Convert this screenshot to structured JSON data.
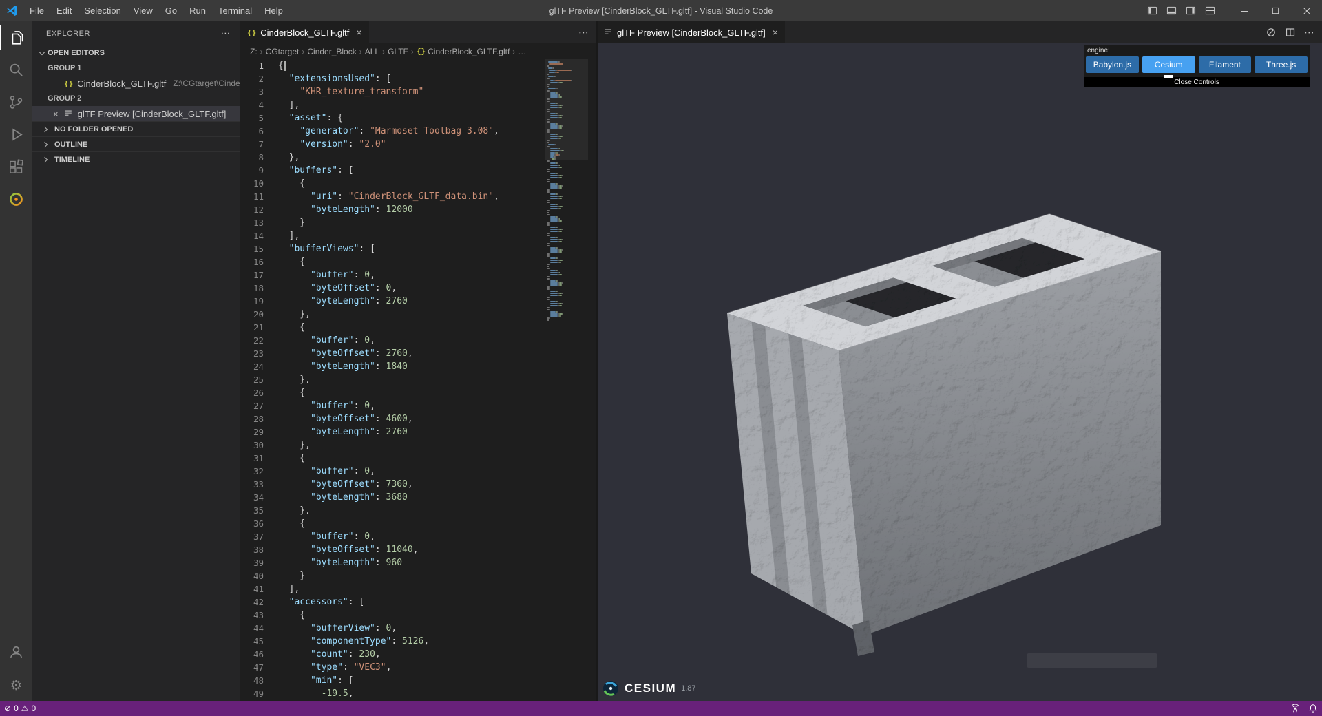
{
  "window": {
    "title": "glTF Preview [CinderBlock_GLTF.gltf] - Visual Studio Code",
    "menus": [
      "File",
      "Edit",
      "Selection",
      "View",
      "Go",
      "Run",
      "Terminal",
      "Help"
    ]
  },
  "explorer": {
    "title": "EXPLORER",
    "open_editors_label": "OPEN EDITORS",
    "group1_label": "GROUP 1",
    "group1_file": {
      "name": "CinderBlock_GLTF.gltf",
      "description": "Z:\\CGtarget\\Cinder…"
    },
    "group2_label": "GROUP 2",
    "group2_item": {
      "name": "glTF Preview [CinderBlock_GLTF.gltf]"
    },
    "sections": [
      {
        "label": "NO FOLDER OPENED"
      },
      {
        "label": "OUTLINE"
      },
      {
        "label": "TIMELINE"
      }
    ]
  },
  "editor": {
    "tab_label": "CinderBlock_GLTF.gltf",
    "breadcrumbs": [
      {
        "label": "Z:"
      },
      {
        "label": "CGtarget"
      },
      {
        "label": "Cinder_Block"
      },
      {
        "label": "ALL"
      },
      {
        "label": "GLTF"
      },
      {
        "label": "CinderBlock_GLTF.gltf",
        "icon": "json"
      },
      {
        "label": "…"
      }
    ],
    "code": {
      "lines": [
        [
          [
            "pl",
            "{"
          ]
        ],
        [
          [
            "pl",
            "  "
          ],
          [
            "k",
            "\"extensionsUsed\""
          ],
          [
            "pl",
            ": ["
          ]
        ],
        [
          [
            "pl",
            "    "
          ],
          [
            "s",
            "\"KHR_texture_transform\""
          ]
        ],
        [
          [
            "pl",
            "  ],"
          ]
        ],
        [
          [
            "pl",
            "  "
          ],
          [
            "k",
            "\"asset\""
          ],
          [
            "pl",
            ": {"
          ]
        ],
        [
          [
            "pl",
            "    "
          ],
          [
            "k",
            "\"generator\""
          ],
          [
            "pl",
            ": "
          ],
          [
            "s",
            "\"Marmoset Toolbag 3.08\""
          ],
          [
            "pl",
            ","
          ]
        ],
        [
          [
            "pl",
            "    "
          ],
          [
            "k",
            "\"version\""
          ],
          [
            "pl",
            ": "
          ],
          [
            "s",
            "\"2.0\""
          ]
        ],
        [
          [
            "pl",
            "  },"
          ]
        ],
        [
          [
            "pl",
            "  "
          ],
          [
            "k",
            "\"buffers\""
          ],
          [
            "pl",
            ": ["
          ]
        ],
        [
          [
            "pl",
            "    {"
          ]
        ],
        [
          [
            "pl",
            "      "
          ],
          [
            "k",
            "\"uri\""
          ],
          [
            "pl",
            ": "
          ],
          [
            "s",
            "\"CinderBlock_GLTF_data.bin\""
          ],
          [
            "pl",
            ","
          ]
        ],
        [
          [
            "pl",
            "      "
          ],
          [
            "k",
            "\"byteLength\""
          ],
          [
            "pl",
            ": "
          ],
          [
            "n",
            "12000"
          ]
        ],
        [
          [
            "pl",
            "    }"
          ]
        ],
        [
          [
            "pl",
            "  ],"
          ]
        ],
        [
          [
            "pl",
            "  "
          ],
          [
            "k",
            "\"bufferViews\""
          ],
          [
            "pl",
            ": ["
          ]
        ],
        [
          [
            "pl",
            "    {"
          ]
        ],
        [
          [
            "pl",
            "      "
          ],
          [
            "k",
            "\"buffer\""
          ],
          [
            "pl",
            ": "
          ],
          [
            "n",
            "0"
          ],
          [
            "pl",
            ","
          ]
        ],
        [
          [
            "pl",
            "      "
          ],
          [
            "k",
            "\"byteOffset\""
          ],
          [
            "pl",
            ": "
          ],
          [
            "n",
            "0"
          ],
          [
            "pl",
            ","
          ]
        ],
        [
          [
            "pl",
            "      "
          ],
          [
            "k",
            "\"byteLength\""
          ],
          [
            "pl",
            ": "
          ],
          [
            "n",
            "2760"
          ]
        ],
        [
          [
            "pl",
            "    },"
          ]
        ],
        [
          [
            "pl",
            "    {"
          ]
        ],
        [
          [
            "pl",
            "      "
          ],
          [
            "k",
            "\"buffer\""
          ],
          [
            "pl",
            ": "
          ],
          [
            "n",
            "0"
          ],
          [
            "pl",
            ","
          ]
        ],
        [
          [
            "pl",
            "      "
          ],
          [
            "k",
            "\"byteOffset\""
          ],
          [
            "pl",
            ": "
          ],
          [
            "n",
            "2760"
          ],
          [
            "pl",
            ","
          ]
        ],
        [
          [
            "pl",
            "      "
          ],
          [
            "k",
            "\"byteLength\""
          ],
          [
            "pl",
            ": "
          ],
          [
            "n",
            "1840"
          ]
        ],
        [
          [
            "pl",
            "    },"
          ]
        ],
        [
          [
            "pl",
            "    {"
          ]
        ],
        [
          [
            "pl",
            "      "
          ],
          [
            "k",
            "\"buffer\""
          ],
          [
            "pl",
            ": "
          ],
          [
            "n",
            "0"
          ],
          [
            "pl",
            ","
          ]
        ],
        [
          [
            "pl",
            "      "
          ],
          [
            "k",
            "\"byteOffset\""
          ],
          [
            "pl",
            ": "
          ],
          [
            "n",
            "4600"
          ],
          [
            "pl",
            ","
          ]
        ],
        [
          [
            "pl",
            "      "
          ],
          [
            "k",
            "\"byteLength\""
          ],
          [
            "pl",
            ": "
          ],
          [
            "n",
            "2760"
          ]
        ],
        [
          [
            "pl",
            "    },"
          ]
        ],
        [
          [
            "pl",
            "    {"
          ]
        ],
        [
          [
            "pl",
            "      "
          ],
          [
            "k",
            "\"buffer\""
          ],
          [
            "pl",
            ": "
          ],
          [
            "n",
            "0"
          ],
          [
            "pl",
            ","
          ]
        ],
        [
          [
            "pl",
            "      "
          ],
          [
            "k",
            "\"byteOffset\""
          ],
          [
            "pl",
            ": "
          ],
          [
            "n",
            "7360"
          ],
          [
            "pl",
            ","
          ]
        ],
        [
          [
            "pl",
            "      "
          ],
          [
            "k",
            "\"byteLength\""
          ],
          [
            "pl",
            ": "
          ],
          [
            "n",
            "3680"
          ]
        ],
        [
          [
            "pl",
            "    },"
          ]
        ],
        [
          [
            "pl",
            "    {"
          ]
        ],
        [
          [
            "pl",
            "      "
          ],
          [
            "k",
            "\"buffer\""
          ],
          [
            "pl",
            ": "
          ],
          [
            "n",
            "0"
          ],
          [
            "pl",
            ","
          ]
        ],
        [
          [
            "pl",
            "      "
          ],
          [
            "k",
            "\"byteOffset\""
          ],
          [
            "pl",
            ": "
          ],
          [
            "n",
            "11040"
          ],
          [
            "pl",
            ","
          ]
        ],
        [
          [
            "pl",
            "      "
          ],
          [
            "k",
            "\"byteLength\""
          ],
          [
            "pl",
            ": "
          ],
          [
            "n",
            "960"
          ]
        ],
        [
          [
            "pl",
            "    }"
          ]
        ],
        [
          [
            "pl",
            "  ],"
          ]
        ],
        [
          [
            "pl",
            "  "
          ],
          [
            "k",
            "\"accessors\""
          ],
          [
            "pl",
            ": ["
          ]
        ],
        [
          [
            "pl",
            "    {"
          ]
        ],
        [
          [
            "pl",
            "      "
          ],
          [
            "k",
            "\"bufferView\""
          ],
          [
            "pl",
            ": "
          ],
          [
            "n",
            "0"
          ],
          [
            "pl",
            ","
          ]
        ],
        [
          [
            "pl",
            "      "
          ],
          [
            "k",
            "\"componentType\""
          ],
          [
            "pl",
            ": "
          ],
          [
            "n",
            "5126"
          ],
          [
            "pl",
            ","
          ]
        ],
        [
          [
            "pl",
            "      "
          ],
          [
            "k",
            "\"count\""
          ],
          [
            "pl",
            ": "
          ],
          [
            "n",
            "230"
          ],
          [
            "pl",
            ","
          ]
        ],
        [
          [
            "pl",
            "      "
          ],
          [
            "k",
            "\"type\""
          ],
          [
            "pl",
            ": "
          ],
          [
            "s",
            "\"VEC3\""
          ],
          [
            "pl",
            ","
          ]
        ],
        [
          [
            "pl",
            "      "
          ],
          [
            "k",
            "\"min\""
          ],
          [
            "pl",
            ": ["
          ]
        ],
        [
          [
            "pl",
            "        "
          ],
          [
            "n",
            "-19.5"
          ],
          [
            "pl",
            ","
          ]
        ]
      ]
    }
  },
  "preview": {
    "tab_label": "glTF Preview [CinderBlock_GLTF.gltf]",
    "engine_label": "engine:",
    "engines": [
      {
        "label": "Babylon.js",
        "selected": false
      },
      {
        "label": "Cesium",
        "selected": true
      },
      {
        "label": "Filament",
        "selected": false
      },
      {
        "label": "Three.js",
        "selected": false
      }
    ],
    "close_controls_label": "Close Controls",
    "credit": {
      "brand": "CESIUM",
      "version": "1.87"
    }
  },
  "status_bar": {
    "errors": "0",
    "warnings": "0"
  },
  "icons": {
    "json_file": "{}",
    "close": "×",
    "more_actions": "⋯",
    "error": "⊘",
    "warning": "⚠",
    "gear": "⚙"
  },
  "colors": {
    "status_bar": "#68217a",
    "engine_button": "#2d6ca8",
    "engine_button_selected": "#47a1f1",
    "accent_blue": "#1f9cf0"
  }
}
